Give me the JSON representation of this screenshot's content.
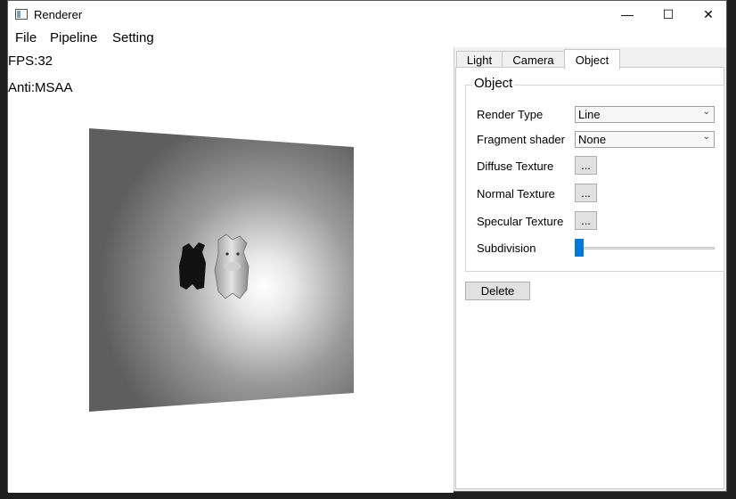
{
  "window": {
    "title": "Renderer",
    "controls": {
      "minimize": "—",
      "maximize": "☐",
      "close": "✕"
    }
  },
  "menu": {
    "items": [
      "File",
      "Pipeline",
      "Setting"
    ]
  },
  "viewport": {
    "fps": "FPS:32",
    "anti": "Anti:MSAA"
  },
  "panel": {
    "tabs": [
      "Light",
      "Camera",
      "Object"
    ],
    "active_tab": "Object",
    "group_title": "Object",
    "render_type": {
      "label": "Render Type",
      "value": "Line"
    },
    "fragment_shader": {
      "label": "Fragment shader",
      "value": "None"
    },
    "diffuse_texture": {
      "label": "Diffuse Texture",
      "button": "..."
    },
    "normal_texture": {
      "label": "Normal Texture",
      "button": "..."
    },
    "specular_texture": {
      "label": "Specular Texture",
      "button": "..."
    },
    "subdivision": {
      "label": "Subdivision",
      "value": 0
    },
    "delete_label": "Delete"
  },
  "colors": {
    "accent": "#0078d7",
    "code_yellow": "#dcdcaa",
    "code_green": "#4ec9b0",
    "code_teal": "#4fc1ff"
  }
}
